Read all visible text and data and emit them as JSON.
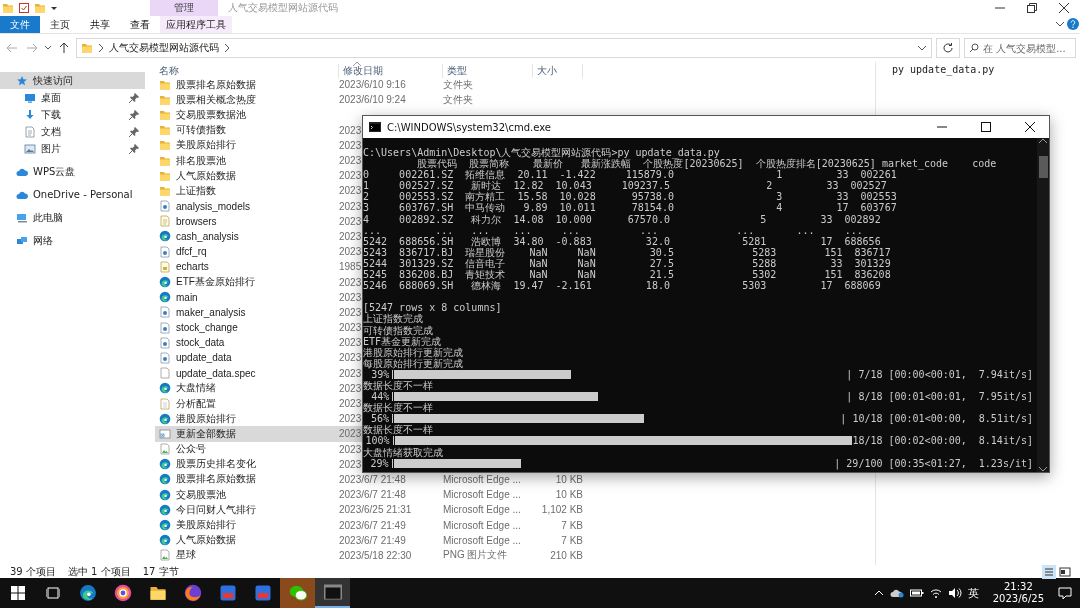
{
  "explorer": {
    "title": "人气交易模型网站源代码",
    "context_group": "管理",
    "ribbon_tabs": [
      {
        "label": "文件",
        "kind": "file"
      },
      {
        "label": "主页",
        "kind": "tab"
      },
      {
        "label": "共享",
        "kind": "tab"
      },
      {
        "label": "查看",
        "kind": "tab"
      },
      {
        "label": "应用程序工具",
        "kind": "context"
      }
    ],
    "address": {
      "path": "人气交易模型网站源代码"
    },
    "search": {
      "placeholder": "在 人气交易模型..."
    },
    "nav": [
      {
        "label": "快速访问",
        "kind": "star",
        "selected": true,
        "children": [
          {
            "label": "桌面",
            "kind": "desktop",
            "pinned": true
          },
          {
            "label": "下载",
            "kind": "download",
            "pinned": true
          },
          {
            "label": "文档",
            "kind": "doc",
            "pinned": true
          },
          {
            "label": "图片",
            "kind": "picture",
            "pinned": true
          }
        ]
      },
      {
        "label": "WPS云盘",
        "kind": "cloud",
        "selected": false
      },
      {
        "label": "OneDrive - Personal",
        "kind": "cloud",
        "selected": false
      },
      {
        "label": "此电脑",
        "kind": "pc",
        "selected": false
      },
      {
        "label": "网络",
        "kind": "network",
        "selected": false
      }
    ],
    "columns": [
      "名称",
      "修改日期",
      "类型",
      "大小"
    ],
    "rows": [
      {
        "name": "股票排名原始数据",
        "kind": "folder",
        "date": "2023/6/10 9:16",
        "type": "文件夹",
        "selected": false
      },
      {
        "name": "股票相关概念热度",
        "kind": "folder",
        "date": "2023/6/10 9:24",
        "type": "文件夹",
        "selected": false
      },
      {
        "name": "交易股票数据池",
        "kind": "folder",
        "selected": false
      },
      {
        "name": "可转债指数",
        "kind": "folder",
        "date": "2023",
        "selected": false
      },
      {
        "name": "美股原始排行",
        "kind": "folder",
        "date": "2023",
        "selected": false
      },
      {
        "name": "排名股票池",
        "kind": "folder",
        "date": "2023",
        "selected": false
      },
      {
        "name": "人气原始数据",
        "kind": "folder",
        "date": "2023",
        "selected": false
      },
      {
        "name": "上证指数",
        "kind": "folder",
        "date": "2023",
        "selected": false
      },
      {
        "name": "analysis_models",
        "kind": "py",
        "date": "2023",
        "selected": false
      },
      {
        "name": "browsers",
        "kind": "json",
        "date": "2023",
        "selected": false
      },
      {
        "name": "cash_analysis",
        "kind": "edge",
        "date": "2023",
        "selected": false
      },
      {
        "name": "dfcf_rq",
        "kind": "py",
        "date": "2023",
        "selected": false
      },
      {
        "name": "echarts",
        "kind": "js",
        "date": "1985",
        "selected": false
      },
      {
        "name": "ETF基金原始排行",
        "kind": "edge",
        "date": "2023",
        "selected": false
      },
      {
        "name": "main",
        "kind": "edge",
        "date": "2023",
        "selected": false
      },
      {
        "name": "maker_analysis",
        "kind": "py",
        "date": "2023",
        "selected": false
      },
      {
        "name": "stock_change",
        "kind": "py",
        "date": "2023",
        "selected": false
      },
      {
        "name": "stock_data",
        "kind": "py",
        "date": "2023",
        "selected": false
      },
      {
        "name": "update_data",
        "kind": "py",
        "date": "2023",
        "selected": false
      },
      {
        "name": "update_data.spec",
        "kind": "file",
        "date": "2023",
        "selected": false
      },
      {
        "name": "大盘情绪",
        "kind": "edge",
        "date": "2023",
        "selected": false
      },
      {
        "name": "分析配置",
        "kind": "ini",
        "date": "2023",
        "selected": false
      },
      {
        "name": "港股原始排行",
        "kind": "edge",
        "date": "2023",
        "selected": false
      },
      {
        "name": "更新全部数据",
        "kind": "shortcut",
        "date": "2023",
        "selected": true
      },
      {
        "name": "公众号",
        "kind": "image",
        "date": "2023",
        "selected": false
      },
      {
        "name": "股票历史排名变化",
        "kind": "edge",
        "date": "2023",
        "selected": false
      },
      {
        "name": "股票排名原始数据",
        "kind": "edge",
        "date": "2023/6/7 21:48",
        "type": "Microsoft Edge ...",
        "size": "10 KB",
        "selected": false
      },
      {
        "name": "交易股票池",
        "kind": "edge",
        "date": "2023/6/7 21:48",
        "type": "Microsoft Edge ...",
        "size": "10 KB",
        "selected": false
      },
      {
        "name": "今日问财人气排行",
        "kind": "edge",
        "date": "2023/6/25 21:31",
        "type": "Microsoft Edge ...",
        "size": "1,102 KB",
        "selected": false
      },
      {
        "name": "美股原始排行",
        "kind": "edge",
        "date": "2023/6/7 21:49",
        "type": "Microsoft Edge ...",
        "size": "7 KB",
        "selected": false
      },
      {
        "name": "人气原始数据",
        "kind": "edge",
        "date": "2023/6/7 21:49",
        "type": "Microsoft Edge ...",
        "size": "7 KB",
        "selected": false
      },
      {
        "name": "星球",
        "kind": "image",
        "date": "2023/5/18 22:30",
        "type": "PNG 图片文件",
        "size": "210 KB",
        "selected": false
      }
    ],
    "preview_text": "py update_data.py",
    "status_bar": {
      "count": "39 个项目",
      "selection": "选中 1 个项目",
      "size": "17 字节"
    }
  },
  "cmd": {
    "title": "C:\\WINDOWS\\system32\\cmd.exe",
    "lines": [
      {
        "kind": "text",
        "text": "C:\\Users\\Admin\\Desktop\\人气交易模型网站源代码>py update_data.py"
      },
      {
        "kind": "text",
        "text": "         股票代码  股票简称    最新价   最新涨跌幅  个股热度[20230625]  个股热度排名[20230625] market_code    code"
      },
      {
        "kind": "text",
        "text": "0     002261.SZ  拓维信息  20.11  -1.422     115879.0                 1         33  002261"
      },
      {
        "kind": "text",
        "text": "1     002527.SZ   新时达  12.82  10.043     109237.5                2         33  002527"
      },
      {
        "kind": "text",
        "text": "2     002553.SZ  南方精工  15.58  10.028      95738.0                 3         33  002553"
      },
      {
        "kind": "text",
        "text": "3     603767.SH  中马传动   9.89  10.011      78154.0                 4         17  603767"
      },
      {
        "kind": "text",
        "text": "4     002892.SZ   科力尔  14.08  10.000      67570.0               5         33  002892"
      },
      {
        "kind": "text",
        "text": "...         ...   ...    ...     ...          ...             ...       ...     ..."
      },
      {
        "kind": "text",
        "text": "5242  688656.SH   浩欧博  34.80  -0.883         32.0            5281         17  688656"
      },
      {
        "kind": "text",
        "text": "5243  836717.BJ  瑞星股份    NaN     NaN         30.5             5283        151  836717"
      },
      {
        "kind": "text",
        "text": "5244  301329.SZ  信音电子    NaN     NaN         27.5             5288         33  301329"
      },
      {
        "kind": "text",
        "text": "5245  836208.BJ  青矩技术    NaN     NaN         21.5             5302        151  836208"
      },
      {
        "kind": "text",
        "text": "5246  688069.SH   德林海  19.47  -2.161         18.0            5303         17  688069"
      },
      {
        "kind": "blank"
      },
      {
        "kind": "text",
        "text": "[5247 rows x 8 columns]"
      },
      {
        "kind": "text",
        "text": "上证指数完成"
      },
      {
        "kind": "text",
        "text": "可转债指数完成"
      },
      {
        "kind": "text",
        "text": "ETF基金更新完成"
      },
      {
        "kind": "text",
        "text": "港股原始排行更新完成"
      },
      {
        "kind": "text",
        "text": "每股原始排行更新完成"
      },
      {
        "kind": "progress",
        "percent": "39%",
        "level": 0.39,
        "stats": "| 7/18 [00:00<00:01,  7.94it/s]"
      },
      {
        "kind": "text",
        "text": "数据长度不一样"
      },
      {
        "kind": "progress",
        "percent": "44%",
        "level": 0.45,
        "stats": "| 8/18 [00:01<00:01,  7.95it/s]"
      },
      {
        "kind": "text",
        "text": "数据长度不一样"
      },
      {
        "kind": "progress",
        "percent": "56%",
        "level": 0.56,
        "stats": "| 10/18 [00:01<00:00,  8.51it/s]"
      },
      {
        "kind": "text",
        "text": "数据长度不一样"
      },
      {
        "kind": "progress",
        "percent": "100%",
        "level": 1,
        "stats": "18/18 [00:02<00:00,  8.14it/s]"
      },
      {
        "kind": "text",
        "text": "大盘情绪获取完成"
      },
      {
        "kind": "progress",
        "percent": "29%",
        "level": 0.29,
        "stats": "| 29/100 [00:35<01:27,  1.23s/it]"
      }
    ]
  },
  "taskbar": {
    "apps": [
      {
        "kind": "edge",
        "highlighted": false
      },
      {
        "kind": "ring",
        "highlighted": false
      },
      {
        "kind": "folder",
        "highlighted": false
      },
      {
        "kind": "globe",
        "highlighted": false
      },
      {
        "kind": "tile",
        "highlighted": false
      },
      {
        "kind": "tile",
        "highlighted": false
      },
      {
        "kind": "chat",
        "highlighted": true
      },
      {
        "kind": "terminal",
        "highlighted": false,
        "active": true
      }
    ],
    "ime": "英",
    "time": "21:32",
    "date": "2023/6/25"
  }
}
